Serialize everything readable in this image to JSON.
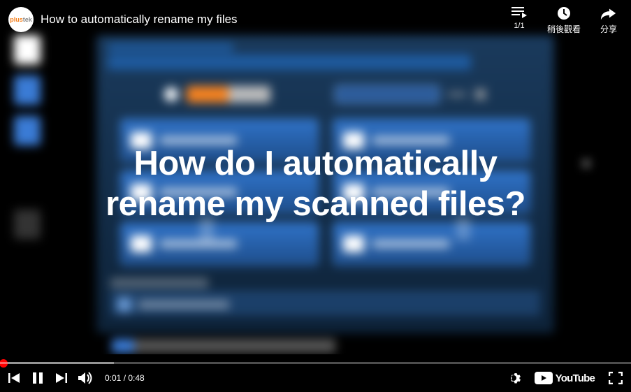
{
  "header": {
    "logo_brand_1": "plus",
    "logo_brand_2": "tek",
    "title": "How to automatically rename my files",
    "playlist_count": "1/1",
    "watch_later": "稍後觀看",
    "share": "分享"
  },
  "overlay": {
    "line1": "How do I automatically",
    "line2": "rename my scanned files?"
  },
  "controls": {
    "current_time": "0:01",
    "separator": " / ",
    "duration": "0:48",
    "youtube": "YouTube"
  }
}
